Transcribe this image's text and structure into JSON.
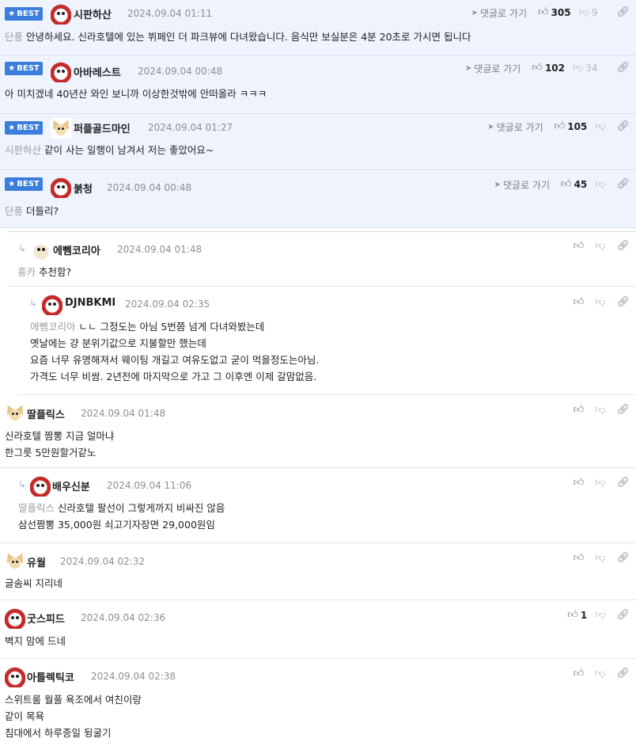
{
  "labels": {
    "best": "BEST",
    "goto": "댓글로 가기"
  },
  "comments": [
    {
      "nick": "시판하산",
      "date": "2024.09.04 01:11",
      "likes": "305",
      "dislikes": "9",
      "tag": "단풍",
      "text": "안녕하세요. 신라호텔에 있는 뷔페인 더 파크뷰에 다녀왔습니다. 음식만 보실분은 4분 20초로 가시면 됩니다"
    },
    {
      "nick": "아바레스트",
      "date": "2024.09.04 00:48",
      "likes": "102",
      "dislikes": "34",
      "tag": "",
      "text": "아 미치겠네 40년산 와인 보니까 이상한것밖에 안떠올라 ㅋㅋㅋ"
    },
    {
      "nick": "퍼플골드마인",
      "date": "2024.09.04 01:27",
      "likes": "105",
      "dislikes": "",
      "tag": "시판하산",
      "text": "같이 사는 일행이 남겨서 저는 좋았어요~"
    },
    {
      "nick": "붉청",
      "date": "2024.09.04 00:48",
      "likes": "45",
      "dislikes": "",
      "tag": "단풍",
      "text": "더들리?"
    },
    {
      "nick": "에뻼코리아",
      "date": "2024.09.04 01:48",
      "likes": "",
      "tag": "흥카",
      "text": "추천함?"
    },
    {
      "nick": "DJNBKMI",
      "date": "2024.09.04 02:35",
      "likes": "",
      "tag": "에뻼코리아",
      "lines": [
        "ㄴㄴ 그정도는 아님 5번쯤 넘게 다녀와봤는데",
        "옛날에는 걍 분위기값으로 지불할만 했는데",
        "요즘 너무 유명해져서 웨이팅 개길고 여유도없고 굳이 먹을정도는아님.",
        "가격도 너무 비쌈. 2년전에 마지막으로 가고 그 이후엔 이제 갈맘없음."
      ]
    },
    {
      "nick": "딸플릭스",
      "date": "2024.09.04 01:48",
      "likes": "",
      "lines": [
        "신라호텔 짬뽕 지금 얼마냐",
        "한그릇 5만원할거같노"
      ]
    },
    {
      "nick": "배우신분",
      "date": "2024.09.04 11:06",
      "likes": "",
      "tag": "딸플릭스",
      "lines": [
        "신라호텔 팔선이 그렇게까지 비싸진 않음",
        "삼선짬뽕 35,000원 쇠고기자장면 29,000원임"
      ]
    },
    {
      "nick": "유월",
      "date": "2024.09.04 02:32",
      "likes": "",
      "text": "글솜씨 지리네"
    },
    {
      "nick": "굿스피드",
      "date": "2024.09.04 02:36",
      "likes": "1",
      "text": "벽지 맘에 드네"
    },
    {
      "nick": "아틀렉틱코",
      "date": "2024.09.04 02:38",
      "likes": "",
      "lines": [
        "스위트룸 월풀 욕조에서 여친이랑",
        "같이 목욕",
        "침대에서 하루종일 뒹굴기"
      ]
    }
  ],
  "colors": {
    "best_bg": "#eef3fd",
    "badge": "#3b7ddb",
    "muted": "#8a8f98"
  }
}
